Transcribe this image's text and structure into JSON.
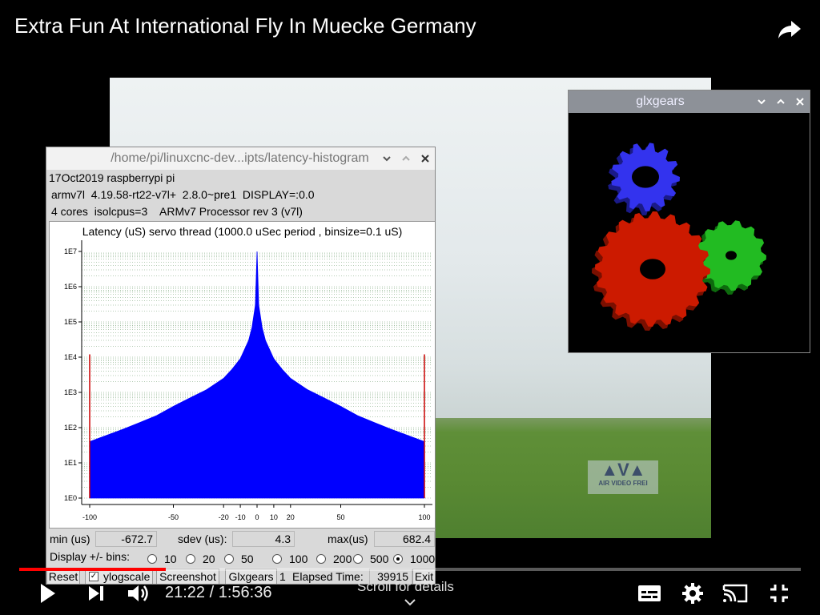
{
  "player": {
    "title": "Extra Fun At International Fly In Muecke Germany",
    "time_label": "21:22 / 1:56:36",
    "scroll_hint": "Scroll for details",
    "progress_fraction": 0.187,
    "watermark_text": "AIR VIDEO FREI",
    "icons": [
      "share-icon",
      "play-icon",
      "next-icon",
      "volume-icon",
      "subtitles-icon",
      "settings-icon",
      "cast-icon",
      "exit-fullscreen-icon"
    ]
  },
  "latency_window": {
    "title": "/home/pi/linuxcnc-dev...ipts/latency-histogram",
    "info_line1": "17Oct2019 raspberrypi pi",
    "info_line2": "armv7l  4.19.58-rt22-v7l+  2.8.0~pre1  DISPLAY=:0.0",
    "info_line3": "4 cores  isolcpus=3    ARMv7 Processor rev 3 (v7l)",
    "min_label": "min (us)",
    "min_value": "-672.7",
    "sdev_label": "sdev (us):",
    "sdev_value": "4.3",
    "max_label": "max(us)",
    "max_value": "682.4",
    "display_bins_label": "Display +/- bins:",
    "bin_options": [
      "10",
      "20",
      "50",
      "100",
      "200",
      "500",
      "1000"
    ],
    "selected_bin": "1000",
    "reset_label": "Reset",
    "ylogscale_label": "ylogscale",
    "ylogscale_checked": true,
    "screenshot_label": "Screenshot",
    "glxgears_label": "Glxgears",
    "glxgears_count": "1",
    "elapsed_label": "Elapsed Time:",
    "elapsed_value": "39915",
    "exit_label": "Exit"
  },
  "glx_window": {
    "title": "glxgears"
  },
  "chart_data": {
    "type": "bar",
    "title": "Latency (uS) servo thread (1000.0 uSec period , binsize=0.1 uS)",
    "xlabel": "",
    "ylabel": "",
    "x_ticks": [
      "-100",
      "-50",
      "-20",
      "-10",
      "0",
      "10",
      "20",
      "50",
      "100"
    ],
    "x_tick_values": [
      -100,
      -50,
      -20,
      -10,
      0,
      10,
      20,
      50,
      100
    ],
    "y_ticks": [
      "1E0",
      "1E1",
      "1E2",
      "1E3",
      "1E4",
      "1E5",
      "1E6",
      "1E7"
    ],
    "xlim": [
      -100,
      100
    ],
    "ylim": [
      1,
      10000000
    ],
    "y_scale": "log",
    "grid": true,
    "color": "#0000ff",
    "profile": {
      "x": [
        -100,
        -90,
        -80,
        -70,
        -60,
        -50,
        -40,
        -30,
        -20,
        -15,
        -10,
        -5,
        -3,
        -1,
        0,
        1,
        3,
        5,
        10,
        15,
        20,
        30,
        40,
        50,
        60,
        70,
        80,
        90,
        100
      ],
      "y": [
        40,
        60,
        90,
        140,
        220,
        400,
        700,
        1200,
        2500,
        4500,
        9000,
        30000,
        70000,
        300000,
        10000000,
        300000,
        70000,
        30000,
        9000,
        4500,
        2500,
        1200,
        700,
        400,
        220,
        140,
        90,
        60,
        40
      ]
    },
    "edge_spikes": [
      {
        "x": -100,
        "y": 12000
      },
      {
        "x": 100,
        "y": 12000
      }
    ]
  }
}
